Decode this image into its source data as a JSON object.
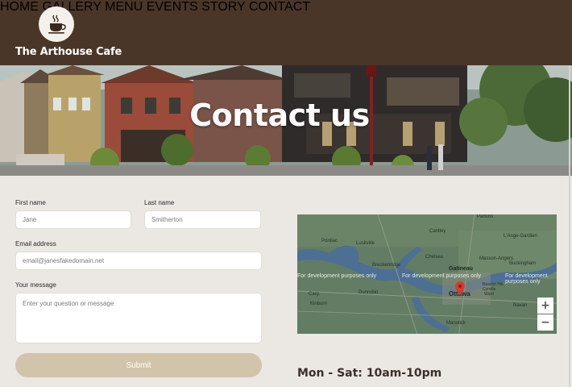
{
  "header": {
    "brand": "The Arthouse Cafe",
    "logo_icon": "coffee-cup-icon",
    "nav": [
      "HOME",
      "GALLERY",
      "MENU",
      "EVENTS",
      "STORY",
      "CONTACT"
    ]
  },
  "hero": {
    "title": "Contact us"
  },
  "form": {
    "first_name_label": "First name",
    "first_name_placeholder": "Jane",
    "last_name_label": "Last name",
    "last_name_placeholder": "Smitherton",
    "email_label": "Email address",
    "email_placeholder": "email@janesfakedomain.net",
    "message_label": "Your message",
    "message_placeholder": "Enter your question or message",
    "submit_label": "Submit"
  },
  "map": {
    "watermark": "For development purposes only",
    "places": [
      "Parkins",
      "Pontiac",
      "Luskville",
      "Cantley",
      "L'Ange-Gardien",
      "Breckenridge",
      "Chelsea",
      "Gatineau",
      "Buckingham",
      "Masson-Angers",
      "Ottawa",
      "Kinburn",
      "Dunrobin",
      "Carp",
      "Navan",
      "Manotick",
      "Beacon Hill-Cyrville",
      "Ward"
    ],
    "zoom_in": "+",
    "zoom_out": "−"
  },
  "hours": "Mon - Sat: 10am-10pm",
  "colors": {
    "header_bg": "#4a3628",
    "nav_text": "#d9ccb7",
    "page_bg": "#ebe8e3",
    "submit_bg": "#d1c4ab",
    "marker": "#d93a2f"
  }
}
